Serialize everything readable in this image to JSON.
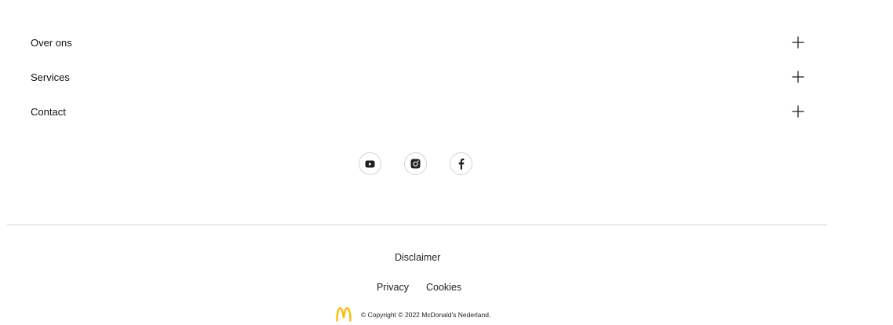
{
  "accordion": {
    "items": [
      {
        "label": "Over ons",
        "icon": "plus-icon"
      },
      {
        "label": "Services",
        "icon": "plus-icon"
      },
      {
        "label": "Contact",
        "icon": "plus-icon"
      }
    ]
  },
  "social": {
    "icons": [
      "youtube-icon",
      "instagram-icon",
      "facebook-icon"
    ]
  },
  "legal": {
    "disclaimer": "Disclaimer",
    "privacy": "Privacy",
    "cookies": "Cookies"
  },
  "footer": {
    "logo": "mcdonalds-arches-logo",
    "logo_color": "#FFBC0D",
    "copyright": "© Copyright © 2022 McDonald's Nederland."
  }
}
